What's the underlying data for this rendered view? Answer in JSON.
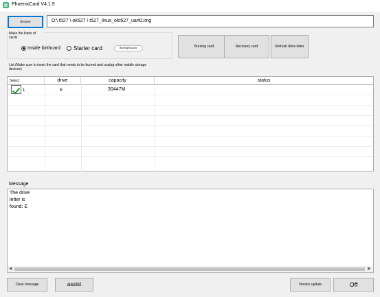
{
  "window": {
    "title": "PhoenixCard V4.1.9"
  },
  "toolbar": {
    "browse_label": "Browse",
    "image_path": "D:\\ t527 \\ ok527 \\ t527_linux_okt527_uart0.img"
  },
  "card_kind": {
    "label": "Make the kinds of cards",
    "option_inside": "Inside birthcard",
    "option_starter": "Starter card",
    "toggle_label": "BurningKeycard",
    "selected": "Inside birthcard"
  },
  "actions": {
    "burning_card": "Burning card",
    "recovery_card": "Recovery card",
    "refresh_drive": "Refresh drive letter"
  },
  "list": {
    "label": "List (Make sure to insert the card that needs to be burned and unplug other mobile storage devices)",
    "columns": [
      "Select",
      "drive",
      "capacity",
      "status"
    ],
    "rows": [
      {
        "select": "1",
        "checked": true,
        "drive": "E",
        "capacity": "30447M",
        "status": ""
      }
    ]
  },
  "message": {
    "label": "Message",
    "text": "The drive\nletter is\nfound: E"
  },
  "footer": {
    "clear_message": "Clear message",
    "assist": "assist",
    "version_update": "Version update",
    "off": "Off"
  },
  "colors": {
    "focus_border": "#0078d7",
    "button_bg": "#e1e1e1",
    "check_green": "#1a9c3a"
  }
}
